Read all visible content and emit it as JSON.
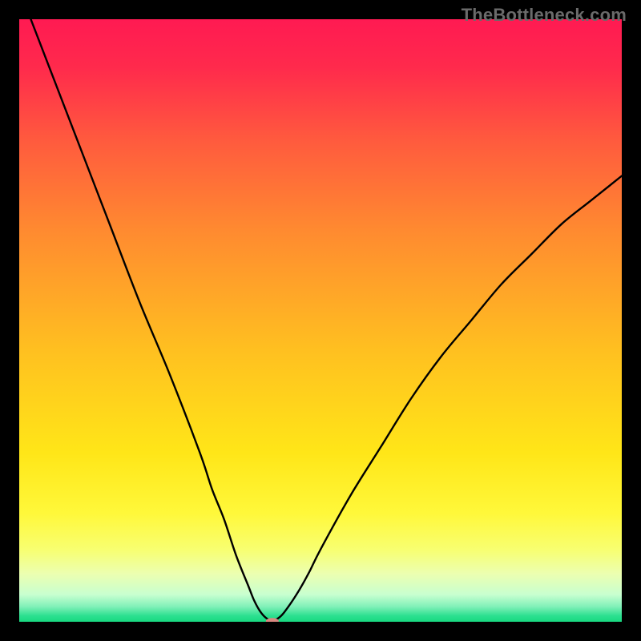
{
  "watermark": "TheBottleneck.com",
  "chart_data": {
    "type": "line",
    "title": "",
    "xlabel": "",
    "ylabel": "",
    "xlim": [
      0,
      100
    ],
    "ylim": [
      0,
      100
    ],
    "grid": false,
    "legend": false,
    "series": [
      {
        "name": "curve",
        "x": [
          0,
          5,
          10,
          15,
          20,
          25,
          30,
          32,
          34,
          36,
          38,
          39,
          40,
          41,
          42,
          43,
          44,
          46,
          48,
          50,
          55,
          60,
          65,
          70,
          75,
          80,
          85,
          90,
          95,
          100
        ],
        "values": [
          105,
          92,
          79,
          66,
          53,
          41,
          28,
          22,
          17,
          11,
          6,
          3.5,
          1.7,
          0.6,
          0.15,
          0.6,
          1.6,
          4.5,
          8,
          12,
          21,
          29,
          37,
          44,
          50,
          56,
          61,
          66,
          70,
          74
        ]
      }
    ],
    "notch": {
      "x": 42,
      "y": 0.15
    },
    "marker": {
      "x": 42,
      "y": 0.1,
      "color": "#d98880",
      "rx": 8,
      "ry": 4
    },
    "background_gradient": {
      "stops": [
        {
          "offset": 0.0,
          "color": "#ff1a52"
        },
        {
          "offset": 0.08,
          "color": "#ff2a4c"
        },
        {
          "offset": 0.2,
          "color": "#ff5a3e"
        },
        {
          "offset": 0.35,
          "color": "#ff8a30"
        },
        {
          "offset": 0.55,
          "color": "#ffc020"
        },
        {
          "offset": 0.72,
          "color": "#ffe618"
        },
        {
          "offset": 0.82,
          "color": "#fff83a"
        },
        {
          "offset": 0.88,
          "color": "#f8ff70"
        },
        {
          "offset": 0.92,
          "color": "#ecffb0"
        },
        {
          "offset": 0.955,
          "color": "#c8ffd0"
        },
        {
          "offset": 0.975,
          "color": "#80f0b8"
        },
        {
          "offset": 0.99,
          "color": "#2ce090"
        },
        {
          "offset": 1.0,
          "color": "#18d880"
        }
      ]
    }
  }
}
